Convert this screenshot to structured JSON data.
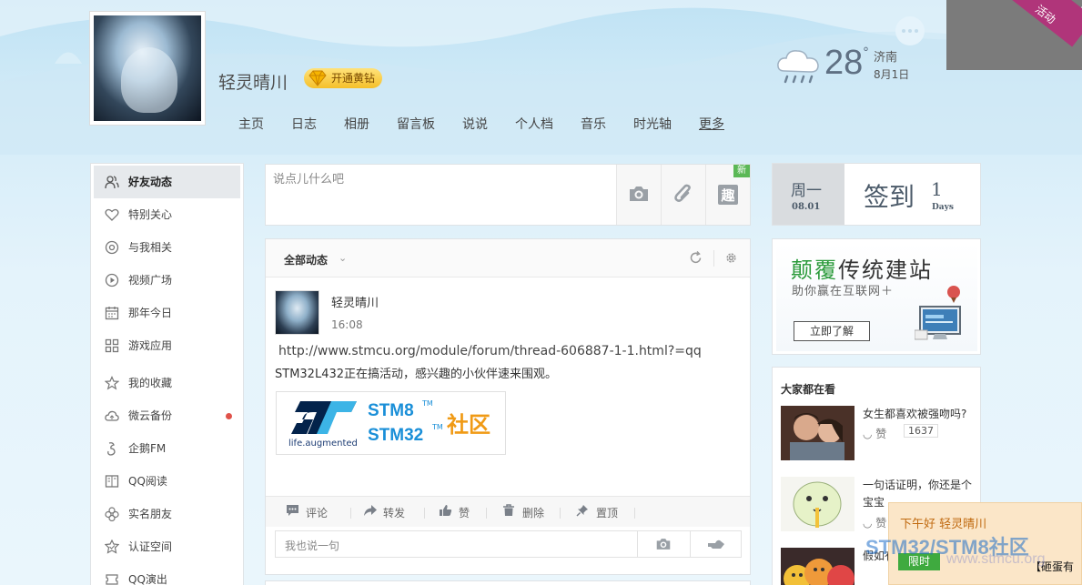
{
  "header": {
    "user_name": "轻灵晴川",
    "vip_label": "开通黄钻",
    "nav": [
      "主页",
      "日志",
      "相册",
      "留言板",
      "说说",
      "个人档",
      "音乐",
      "时光轴"
    ],
    "nav_more": "更多",
    "weather": {
      "temp": "28",
      "degree": "°",
      "city": "济南",
      "date": "8月1日",
      "icon": "rain-cloud-icon"
    },
    "corner_ad": "活动"
  },
  "sidebar": {
    "items": [
      {
        "label": "好友动态",
        "icon": "friends-icon",
        "active": true
      },
      {
        "label": "特别关心",
        "icon": "heart-icon"
      },
      {
        "label": "与我相关",
        "icon": "at-icon"
      },
      {
        "label": "视频广场",
        "icon": "play-icon"
      },
      {
        "label": "那年今日",
        "icon": "calendar-icon"
      },
      {
        "label": "游戏应用",
        "icon": "grid-icon"
      },
      {
        "label": "我的收藏",
        "icon": "star-icon"
      },
      {
        "label": "微云备份",
        "icon": "cloud-icon",
        "dot": true
      },
      {
        "label": "企鹅FM",
        "icon": "fm-icon"
      },
      {
        "label": "QQ阅读",
        "icon": "book-icon"
      },
      {
        "label": "实名朋友",
        "icon": "flower-icon"
      },
      {
        "label": "认证空间",
        "icon": "badge-icon"
      },
      {
        "label": "QQ演出",
        "icon": "ticket-icon"
      }
    ]
  },
  "composer": {
    "placeholder": "说点儿什么吧",
    "new_badge": "新",
    "fun_label": "趣"
  },
  "feed": {
    "filter": "全部动态",
    "post": {
      "author": "轻灵晴川",
      "time": "16:08",
      "link": "http://www.stmcu.org/module/forum/thread-606887-1-1.html?=qq",
      "text": "STM32L432正在搞活动，感兴趣的小伙伴速来围观。",
      "image": {
        "tagline": "life.augmented",
        "stm8": "STM8",
        "stm32": "STM32",
        "tm": "TM",
        "community": "社区"
      }
    },
    "actions": {
      "comment": "评论",
      "forward": "转发",
      "like": "赞",
      "delete": "删除",
      "pin": "置顶"
    },
    "reply_placeholder": "我也说一句"
  },
  "checkin": {
    "weekday": "周一",
    "date": "08.01",
    "label": "签到",
    "count": "1",
    "days_label": "Days"
  },
  "ad": {
    "title_green": "颠覆",
    "title_dark": "传统建站",
    "subtitle": "助你赢在互联网＋",
    "button": "立即了解"
  },
  "hot": {
    "title": "大家都在看",
    "items": [
      {
        "text": "女生都喜欢被强吻吗?",
        "like": "赞",
        "count": "1637"
      },
      {
        "text": "一句话证明，你还是个宝宝",
        "like": "赞"
      },
      {
        "text": "假如有一天，你会，你"
      }
    ]
  },
  "toast": {
    "greeting": "下午好 轻灵晴川",
    "limit": "限时",
    "side_text": "【砸蛋有"
  },
  "watermark": {
    "line1": "STM32/STM8社区",
    "line2": "www.stmcu.org"
  }
}
